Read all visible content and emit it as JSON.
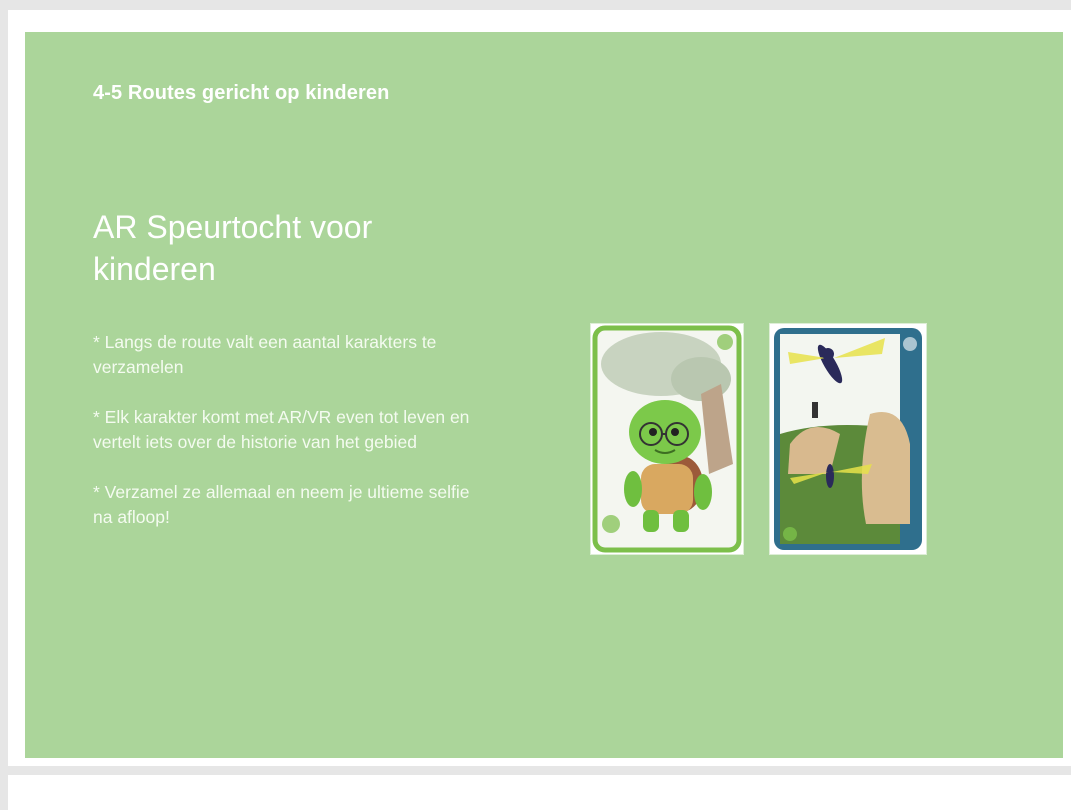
{
  "slide": {
    "section_title": "4-5 Routes gericht op kinderen",
    "main_title": "AR Speurtocht voor kinderen",
    "bullets": [
      "* Langs de route valt een aantal karakters te verzamelen",
      "* Elk karakter komt met AR/VR even tot leven en vertelt iets over de historie van het gebied",
      "* Verzamel ze allemaal en neem je ultieme selfie na afloop!"
    ]
  },
  "cards": [
    {
      "name": "turtle-character-card",
      "border_color": "#7cbf4a"
    },
    {
      "name": "dragonfly-character-card",
      "border_color": "#2f6f8d"
    }
  ],
  "colors": {
    "slide_background": "#abd59a",
    "text": "#ffffff",
    "page_background": "#e6e6e6"
  }
}
